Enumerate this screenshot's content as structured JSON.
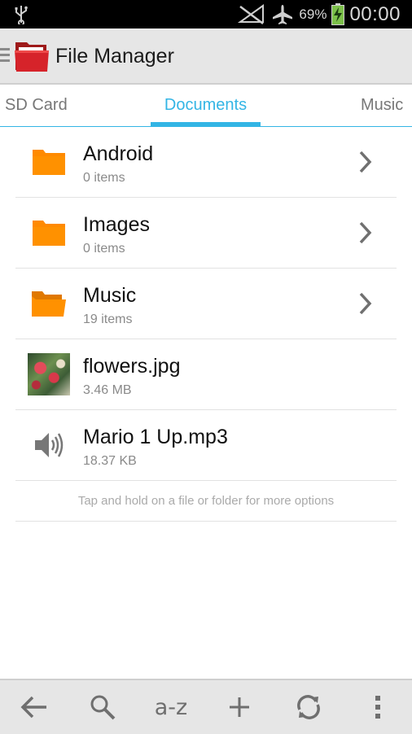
{
  "status_bar": {
    "battery_percent": "69%",
    "time": "00:00",
    "icons": [
      "usb-icon",
      "no-signal-icon",
      "airplane-icon",
      "battery-charging-icon"
    ]
  },
  "action_bar": {
    "title": "File Manager",
    "icons": [
      "menu-icon",
      "app-logo-folder-icon"
    ]
  },
  "tabs": {
    "items": [
      {
        "label": "SD Card"
      },
      {
        "label": "Documents",
        "selected": true
      },
      {
        "label": "Music"
      }
    ],
    "accent_color": "#33b5e5"
  },
  "list": {
    "items": [
      {
        "name": "Android",
        "detail": "0 items",
        "icon": "folder-icon",
        "chevron": true
      },
      {
        "name": "Images",
        "detail": "0 items",
        "icon": "folder-icon",
        "chevron": true
      },
      {
        "name": "Music",
        "detail": "19 items",
        "icon": "folder-open-icon",
        "chevron": true
      },
      {
        "name": "flowers.jpg",
        "detail": "3.46 MB",
        "icon": "image-thumbnail",
        "chevron": false
      },
      {
        "name": "Mario 1 Up.mp3",
        "detail": "18.37 KB",
        "icon": "speaker-icon",
        "chevron": false
      }
    ],
    "hint": "Tap and hold on a file or folder for more options",
    "folder_color": "#ff8a00"
  },
  "bottom_bar": {
    "sort_label": "a-z",
    "icons": [
      "back-arrow-icon",
      "search-icon",
      "sort-az-icon",
      "add-icon",
      "refresh-icon",
      "overflow-menu-icon"
    ]
  }
}
